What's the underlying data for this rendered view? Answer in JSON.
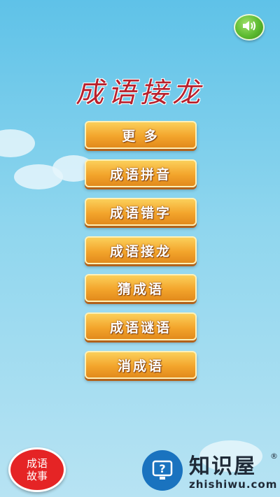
{
  "title": "成语接龙",
  "menu": [
    {
      "label": "更 多"
    },
    {
      "label": "成语拼音"
    },
    {
      "label": "成语错字"
    },
    {
      "label": "成语接龙"
    },
    {
      "label": "猜成语"
    },
    {
      "label": "成语谜语"
    },
    {
      "label": "消成语"
    }
  ],
  "story_button": {
    "label": "成语故事"
  },
  "sound_button": {
    "icon": "speaker-icon",
    "color": "#5cba2f"
  },
  "watermark": {
    "name": "知识屋",
    "registered": "®",
    "url": "zhishiwu.com",
    "icon": "question-monitor-icon"
  }
}
